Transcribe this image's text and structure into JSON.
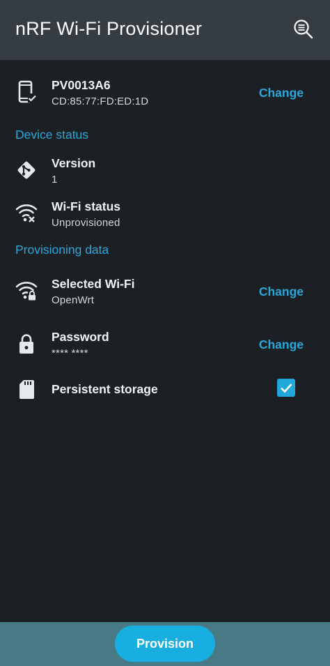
{
  "appbar": {
    "title": "nRF Wi-Fi Provisioner",
    "search_icon": "search-list-icon"
  },
  "device": {
    "name": "PV0013A6",
    "address": "CD:85:77:FD:ED:1D",
    "change_label": "Change",
    "icon": "phone-check-icon"
  },
  "device_status": {
    "header": "Device status",
    "version": {
      "title": "Version",
      "value": "1",
      "icon": "git-icon"
    },
    "wifi_status": {
      "title": "Wi-Fi status",
      "value": "Unprovisioned",
      "icon": "wifi-off-icon"
    }
  },
  "provisioning": {
    "header": "Provisioning data",
    "selected_wifi": {
      "title": "Selected Wi-Fi",
      "value": "OpenWrt",
      "change_label": "Change",
      "icon": "wifi-lock-icon"
    },
    "password": {
      "title": "Password",
      "value": "**** ****",
      "change_label": "Change",
      "icon": "lock-icon"
    },
    "persistent_storage": {
      "title": "Persistent storage",
      "checked": true,
      "icon": "sd-card-icon"
    }
  },
  "footer": {
    "provision_label": "Provision"
  },
  "colors": {
    "accent": "#2aa6d8",
    "appbar": "#353d43",
    "background": "#1c2024",
    "bottombar": "#477a84",
    "button": "#19aee0"
  }
}
